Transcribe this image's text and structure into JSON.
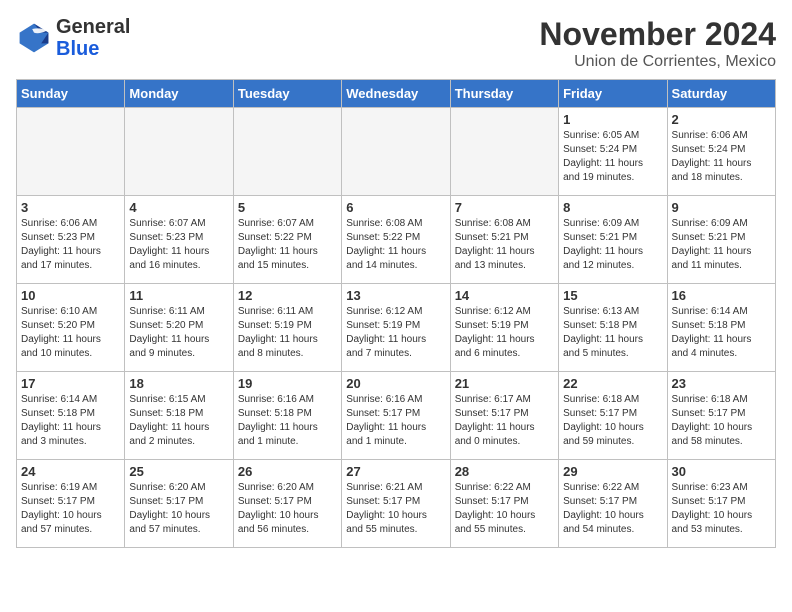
{
  "header": {
    "logo_general": "General",
    "logo_blue": "Blue",
    "month_title": "November 2024",
    "subtitle": "Union de Corrientes, Mexico"
  },
  "weekdays": [
    "Sunday",
    "Monday",
    "Tuesday",
    "Wednesday",
    "Thursday",
    "Friday",
    "Saturday"
  ],
  "weeks": [
    [
      {
        "day": "",
        "detail": ""
      },
      {
        "day": "",
        "detail": ""
      },
      {
        "day": "",
        "detail": ""
      },
      {
        "day": "",
        "detail": ""
      },
      {
        "day": "",
        "detail": ""
      },
      {
        "day": "1",
        "detail": "Sunrise: 6:05 AM\nSunset: 5:24 PM\nDaylight: 11 hours\nand 19 minutes."
      },
      {
        "day": "2",
        "detail": "Sunrise: 6:06 AM\nSunset: 5:24 PM\nDaylight: 11 hours\nand 18 minutes."
      }
    ],
    [
      {
        "day": "3",
        "detail": "Sunrise: 6:06 AM\nSunset: 5:23 PM\nDaylight: 11 hours\nand 17 minutes."
      },
      {
        "day": "4",
        "detail": "Sunrise: 6:07 AM\nSunset: 5:23 PM\nDaylight: 11 hours\nand 16 minutes."
      },
      {
        "day": "5",
        "detail": "Sunrise: 6:07 AM\nSunset: 5:22 PM\nDaylight: 11 hours\nand 15 minutes."
      },
      {
        "day": "6",
        "detail": "Sunrise: 6:08 AM\nSunset: 5:22 PM\nDaylight: 11 hours\nand 14 minutes."
      },
      {
        "day": "7",
        "detail": "Sunrise: 6:08 AM\nSunset: 5:21 PM\nDaylight: 11 hours\nand 13 minutes."
      },
      {
        "day": "8",
        "detail": "Sunrise: 6:09 AM\nSunset: 5:21 PM\nDaylight: 11 hours\nand 12 minutes."
      },
      {
        "day": "9",
        "detail": "Sunrise: 6:09 AM\nSunset: 5:21 PM\nDaylight: 11 hours\nand 11 minutes."
      }
    ],
    [
      {
        "day": "10",
        "detail": "Sunrise: 6:10 AM\nSunset: 5:20 PM\nDaylight: 11 hours\nand 10 minutes."
      },
      {
        "day": "11",
        "detail": "Sunrise: 6:11 AM\nSunset: 5:20 PM\nDaylight: 11 hours\nand 9 minutes."
      },
      {
        "day": "12",
        "detail": "Sunrise: 6:11 AM\nSunset: 5:19 PM\nDaylight: 11 hours\nand 8 minutes."
      },
      {
        "day": "13",
        "detail": "Sunrise: 6:12 AM\nSunset: 5:19 PM\nDaylight: 11 hours\nand 7 minutes."
      },
      {
        "day": "14",
        "detail": "Sunrise: 6:12 AM\nSunset: 5:19 PM\nDaylight: 11 hours\nand 6 minutes."
      },
      {
        "day": "15",
        "detail": "Sunrise: 6:13 AM\nSunset: 5:18 PM\nDaylight: 11 hours\nand 5 minutes."
      },
      {
        "day": "16",
        "detail": "Sunrise: 6:14 AM\nSunset: 5:18 PM\nDaylight: 11 hours\nand 4 minutes."
      }
    ],
    [
      {
        "day": "17",
        "detail": "Sunrise: 6:14 AM\nSunset: 5:18 PM\nDaylight: 11 hours\nand 3 minutes."
      },
      {
        "day": "18",
        "detail": "Sunrise: 6:15 AM\nSunset: 5:18 PM\nDaylight: 11 hours\nand 2 minutes."
      },
      {
        "day": "19",
        "detail": "Sunrise: 6:16 AM\nSunset: 5:18 PM\nDaylight: 11 hours\nand 1 minute."
      },
      {
        "day": "20",
        "detail": "Sunrise: 6:16 AM\nSunset: 5:17 PM\nDaylight: 11 hours\nand 1 minute."
      },
      {
        "day": "21",
        "detail": "Sunrise: 6:17 AM\nSunset: 5:17 PM\nDaylight: 11 hours\nand 0 minutes."
      },
      {
        "day": "22",
        "detail": "Sunrise: 6:18 AM\nSunset: 5:17 PM\nDaylight: 10 hours\nand 59 minutes."
      },
      {
        "day": "23",
        "detail": "Sunrise: 6:18 AM\nSunset: 5:17 PM\nDaylight: 10 hours\nand 58 minutes."
      }
    ],
    [
      {
        "day": "24",
        "detail": "Sunrise: 6:19 AM\nSunset: 5:17 PM\nDaylight: 10 hours\nand 57 minutes."
      },
      {
        "day": "25",
        "detail": "Sunrise: 6:20 AM\nSunset: 5:17 PM\nDaylight: 10 hours\nand 57 minutes."
      },
      {
        "day": "26",
        "detail": "Sunrise: 6:20 AM\nSunset: 5:17 PM\nDaylight: 10 hours\nand 56 minutes."
      },
      {
        "day": "27",
        "detail": "Sunrise: 6:21 AM\nSunset: 5:17 PM\nDaylight: 10 hours\nand 55 minutes."
      },
      {
        "day": "28",
        "detail": "Sunrise: 6:22 AM\nSunset: 5:17 PM\nDaylight: 10 hours\nand 55 minutes."
      },
      {
        "day": "29",
        "detail": "Sunrise: 6:22 AM\nSunset: 5:17 PM\nDaylight: 10 hours\nand 54 minutes."
      },
      {
        "day": "30",
        "detail": "Sunrise: 6:23 AM\nSunset: 5:17 PM\nDaylight: 10 hours\nand 53 minutes."
      }
    ]
  ]
}
